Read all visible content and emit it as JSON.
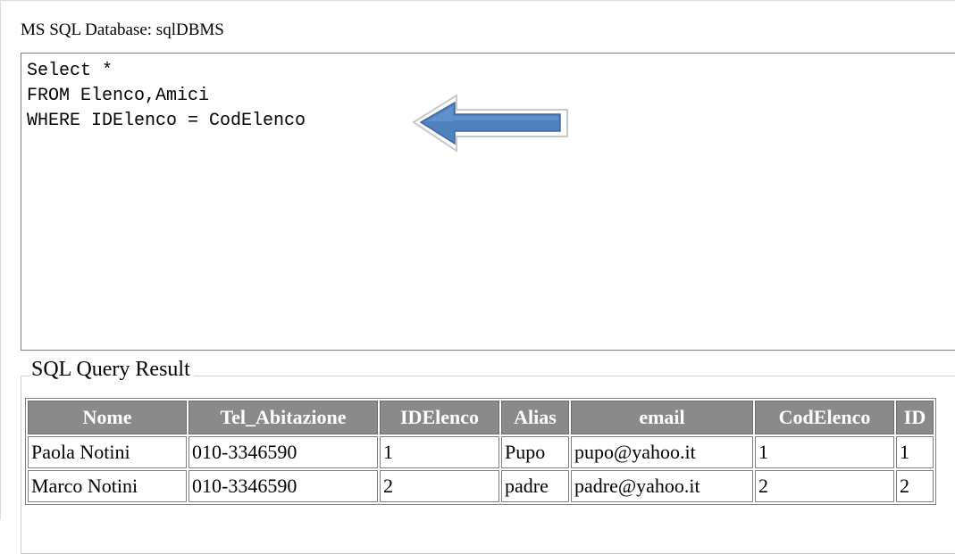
{
  "database_label": "MS SQL Database: sqlDBMS",
  "query": {
    "lines": [
      "Select *",
      "FROM Elenco,Amici",
      "WHERE IDElenco = CodElenco"
    ]
  },
  "annotation": {
    "icon": "left-arrow-icon",
    "color": "#4f81bd"
  },
  "result": {
    "legend": "SQL Query Result",
    "columns": [
      "Nome",
      "Tel_Abitazione",
      "IDElenco",
      "Alias",
      "email",
      "CodElenco",
      "ID"
    ],
    "rows": [
      [
        "Paola Notini",
        "010-3346590",
        "1",
        "Pupo",
        "pupo@yahoo.it",
        "1",
        "1"
      ],
      [
        "Marco Notini",
        "010-3346590",
        "2",
        "padre",
        "padre@yahoo.it",
        "2",
        "2"
      ]
    ],
    "header_bg": "#8a8a8a"
  }
}
